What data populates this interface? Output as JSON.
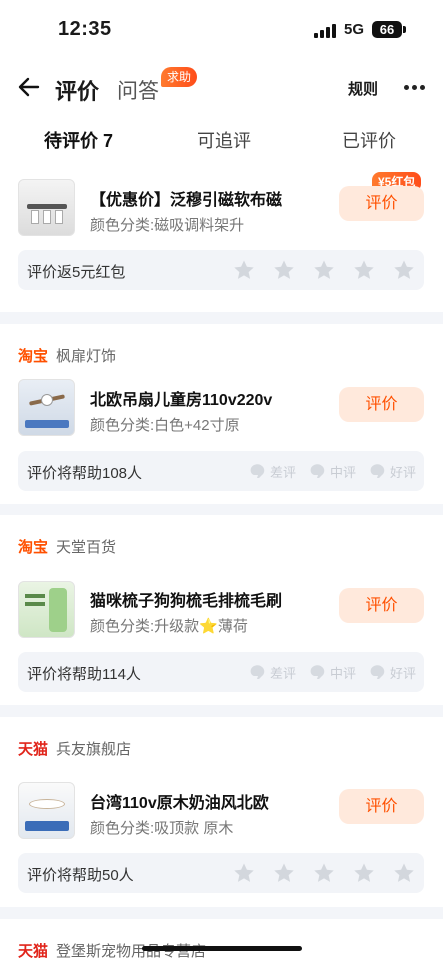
{
  "status_bar": {
    "time": "12:35",
    "network": "5G",
    "battery": "66"
  },
  "nav": {
    "title": "评价",
    "qa": "问答",
    "help_badge": "求助",
    "rules": "规则"
  },
  "tabs": [
    {
      "label": "待评价 7"
    },
    {
      "label": "可追评"
    },
    {
      "label": "已评价"
    }
  ],
  "review_label": "评价",
  "colors": {
    "accent": "#ff5000",
    "button_bg": "#ffe9dc",
    "tmall_red": "#e1251b"
  },
  "cards": [
    {
      "title": "【优惠价】泛穆引磁软布磁",
      "variant": "颜色分类:磁吸调料架升",
      "coupon": "¥5红包",
      "footer": "评价返5元红包",
      "footer_type": "stars",
      "stars": 5
    },
    {
      "shop_logo": "淘宝",
      "shop_name": "枫扉灯饰",
      "title": "北欧吊扇儿童房110v220v",
      "variant": "颜色分类:白色+42寸原",
      "footer": "评价将帮助108人",
      "footer_type": "ratings"
    },
    {
      "shop_logo": "淘宝",
      "shop_name": "天堂百货",
      "title": "猫咪梳子狗狗梳毛排梳毛刷",
      "variant": "颜色分类:升级款⭐薄荷",
      "footer": "评价将帮助114人",
      "footer_type": "ratings"
    },
    {
      "shop_logo": "天猫",
      "shop_name": "兵友旗舰店",
      "title": "台湾110v原木奶油风北欧",
      "variant": "颜色分类:吸顶款 原木",
      "footer": "评价将帮助50人",
      "footer_type": "stars",
      "stars": 5
    },
    {
      "shop_logo": "天猫",
      "shop_name": "登堡斯宠物用品专营店"
    }
  ],
  "rating_labels": {
    "bad": "差评",
    "neutral": "中评",
    "good": "好评"
  }
}
